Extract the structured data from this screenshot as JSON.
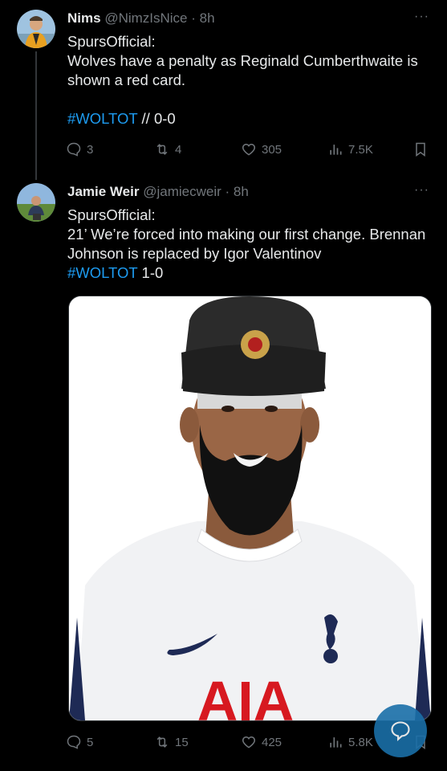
{
  "tweets": [
    {
      "name": "Nims",
      "handle": "@NimzIsNice",
      "sep": " · ",
      "time": "8h",
      "line1": "SpursOfficial:",
      "line2": "Wolves have a penalty as Reginald Cumberthwaite is shown a red card.",
      "hashtag": "#WOLTOT",
      "hashtag_suffix": " // 0-0",
      "replies": "3",
      "reposts": "4",
      "likes": "305",
      "views": "7.5K"
    },
    {
      "name": "Jamie Weir",
      "handle": "@jamiecweir",
      "sep": " · ",
      "time": "8h",
      "line1": "SpursOfficial:",
      "line2": "21’ We’re forced into making our first change. Brennan Johnson is replaced by Igor Valentinov",
      "hashtag": "#WOLTOT",
      "hashtag_suffix": " 1-0",
      "replies": "5",
      "reposts": "15",
      "likes": "425",
      "views": "5.8K",
      "media_sponsor_text": "AIA"
    }
  ],
  "more_label": "···",
  "colors": {
    "link": "#1d9bf0",
    "muted": "#71767b",
    "text": "#e7e9ea"
  }
}
